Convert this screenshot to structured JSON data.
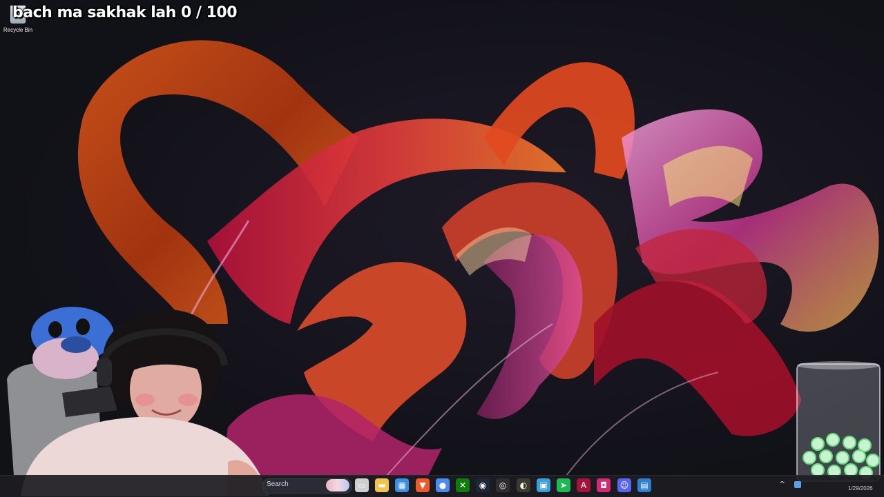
{
  "overlay": {
    "title": "bach ma sakhak lah 0 / 100"
  },
  "desktop_icons": [
    {
      "label": "Recycle Bin",
      "icon": "recycle-bin-icon"
    }
  ],
  "taskbar": {
    "search_label": "Search",
    "apps": [
      {
        "icon": "task-view-icon",
        "color": "#cfcfcf",
        "glyph": "▭"
      },
      {
        "icon": "file-explorer-icon",
        "color": "#f3c44b",
        "glyph": "▬"
      },
      {
        "icon": "microsoft-store-icon",
        "color": "#3a8ee6",
        "glyph": "▦"
      },
      {
        "icon": "brave-browser-icon",
        "color": "#f0592a",
        "glyph": "▼"
      },
      {
        "icon": "chrome-icon",
        "color": "#4c8bf5",
        "glyph": "●"
      },
      {
        "icon": "xbox-icon",
        "color": "#107c10",
        "glyph": "✕"
      },
      {
        "icon": "steam-icon",
        "color": "#1b2838",
        "glyph": "◉"
      },
      {
        "icon": "obs-icon",
        "color": "#302e31",
        "glyph": "◎"
      },
      {
        "icon": "app-icon",
        "color": "#3b3b2b",
        "glyph": "◐"
      },
      {
        "icon": "photos-icon",
        "color": "#3aa0d8",
        "glyph": "▣"
      },
      {
        "icon": "green-app-icon",
        "color": "#1db954",
        "glyph": "➤"
      },
      {
        "icon": "adobe-icon",
        "color": "#a4133c",
        "glyph": "A"
      },
      {
        "icon": "instagram-icon",
        "color": "#d62976",
        "glyph": "◘"
      },
      {
        "icon": "discord-icon",
        "color": "#5865f2",
        "glyph": "☺"
      },
      {
        "icon": "blue-app-icon",
        "color": "#2f7fd0",
        "glyph": "▤"
      }
    ],
    "tray_date": "1/29/2026"
  },
  "colors": {
    "taskbar_bg": "#1c1c22",
    "ribbon_orange": "#e4561b",
    "ribbon_red": "#c8102e",
    "ribbon_pink": "#e14fc6",
    "background": "#15151d"
  }
}
